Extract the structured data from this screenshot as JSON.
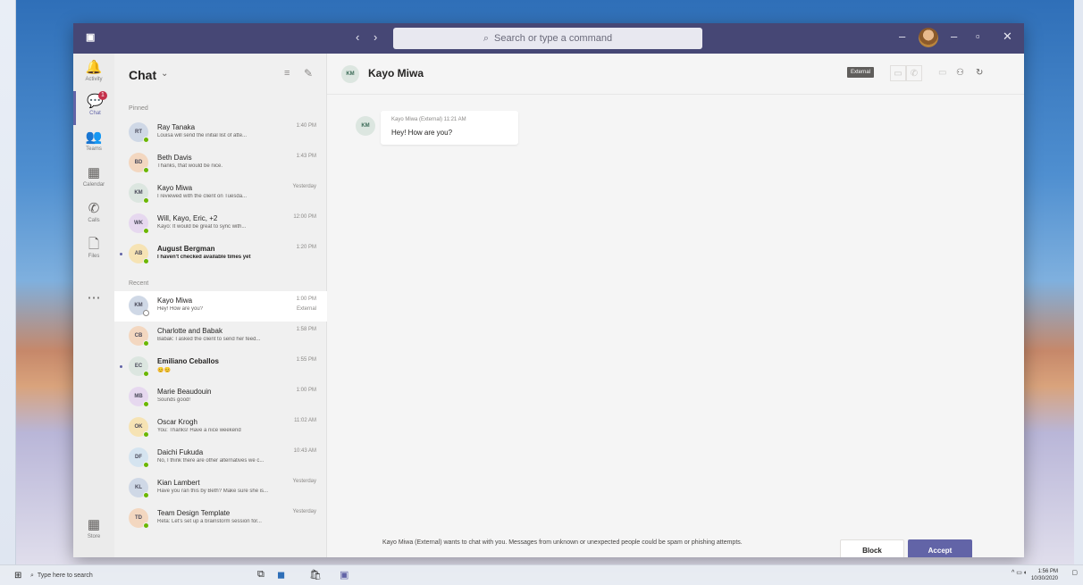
{
  "titlebar": {
    "search_placeholder": "Search or type a command",
    "back_icon": "‹",
    "forward_icon": "›",
    "minimize_icon": "–",
    "maximize_icon": "▫",
    "close_icon": "✕",
    "profile_dash": "–"
  },
  "rail": {
    "items": [
      {
        "label": "Activity",
        "icon": "bell-icon",
        "glyph": "🔔"
      },
      {
        "label": "Chat",
        "icon": "chat-icon",
        "glyph": "💬",
        "badge": "1"
      },
      {
        "label": "Teams",
        "icon": "teams-icon",
        "glyph": "👥"
      },
      {
        "label": "Calendar",
        "icon": "calendar-icon",
        "glyph": "▦"
      },
      {
        "label": "Calls",
        "icon": "phone-icon",
        "glyph": "✆"
      },
      {
        "label": "Files",
        "icon": "file-icon",
        "glyph": "🗋"
      },
      {
        "label": "...",
        "icon": "more-icon",
        "glyph": "⋯"
      },
      {
        "label": "Store",
        "icon": "apps-icon",
        "glyph": "▦"
      }
    ]
  },
  "chatlist": {
    "title": "Chat",
    "chevron": "⌄",
    "filter_icon": "≡",
    "compose_icon": "✎",
    "pinned_label": "Pinned",
    "recent_label": "Recent",
    "pinned": [
      {
        "name": "Ray Tanaka",
        "time": "1:40 PM",
        "preview": "Louisa will send the initial list of atte...",
        "initials": "RT",
        "unread": false
      },
      {
        "name": "Beth Davis",
        "time": "1:43 PM",
        "preview": "Thanks, that would be nice.",
        "initials": "BD",
        "unread": false
      },
      {
        "name": "Kayo Miwa",
        "time": "Yesterday",
        "preview": "I reviewed with the client on Tuesda...",
        "initials": "KM",
        "unread": false
      },
      {
        "name": "Will, Kayo, Eric, +2",
        "time": "12:00 PM",
        "preview": "Kayo: It would be great to sync with...",
        "initials": "WK",
        "unread": false
      },
      {
        "name": "August Bergman",
        "time": "1:20 PM",
        "preview": "I haven't checked available times yet",
        "initials": "AB",
        "unread": true
      }
    ],
    "recent": [
      {
        "name": "Kayo Miwa",
        "time": "1:00 PM",
        "preview": "Hey! How are you?",
        "sub": "External",
        "initials": "KM",
        "unread": false,
        "selected": true
      },
      {
        "name": "Charlotte and Babak",
        "time": "1:58 PM",
        "preview": "Babak: I asked the client to send her feed...",
        "initials": "CB",
        "unread": false
      },
      {
        "name": "Emiliano Ceballos",
        "time": "1:55 PM",
        "preview": "😊😊",
        "initials": "EC",
        "unread": true
      },
      {
        "name": "Marie Beaudouin",
        "time": "1:00 PM",
        "preview": "Sounds good!",
        "initials": "MB",
        "unread": false
      },
      {
        "name": "Oscar Krogh",
        "time": "11:02 AM",
        "preview": "You: Thanks! Have a nice weekend",
        "initials": "OK",
        "unread": false
      },
      {
        "name": "Daichi Fukuda",
        "time": "10:43 AM",
        "preview": "No, I think there are other alternatives we c...",
        "initials": "DF",
        "unread": false
      },
      {
        "name": "Kian Lambert",
        "time": "Yesterday",
        "preview": "Have you ran this by Beth? Make sure she is...",
        "initials": "KL",
        "unread": false
      },
      {
        "name": "Team Design Template",
        "time": "Yesterday",
        "preview": "Reta: Let's set up a brainstorm session for...",
        "initials": "TD",
        "unread": false
      }
    ]
  },
  "conversation": {
    "avatar_initials": "KM",
    "name": "Kayo Miwa",
    "external_badge": "External",
    "message": {
      "sender_meta": "Kayo Miwa (External)  11:21 AM",
      "text": "Hey! How are you?"
    },
    "notice": "Kayo Miwa (External) wants to chat with you. Messages from unknown or unexpected people could be spam or phishing attempts.",
    "block_label": "Block",
    "accept_label": "Accept"
  },
  "taskbar": {
    "search_placeholder": "Type here to search",
    "clock_time": "1:56 PM",
    "clock_date": "10/30/2020"
  },
  "colors": {
    "teams_purple": "#6264a7",
    "titlebar": "#464775",
    "presence_available": "#6bb700",
    "badge_red": "#c4314b"
  }
}
